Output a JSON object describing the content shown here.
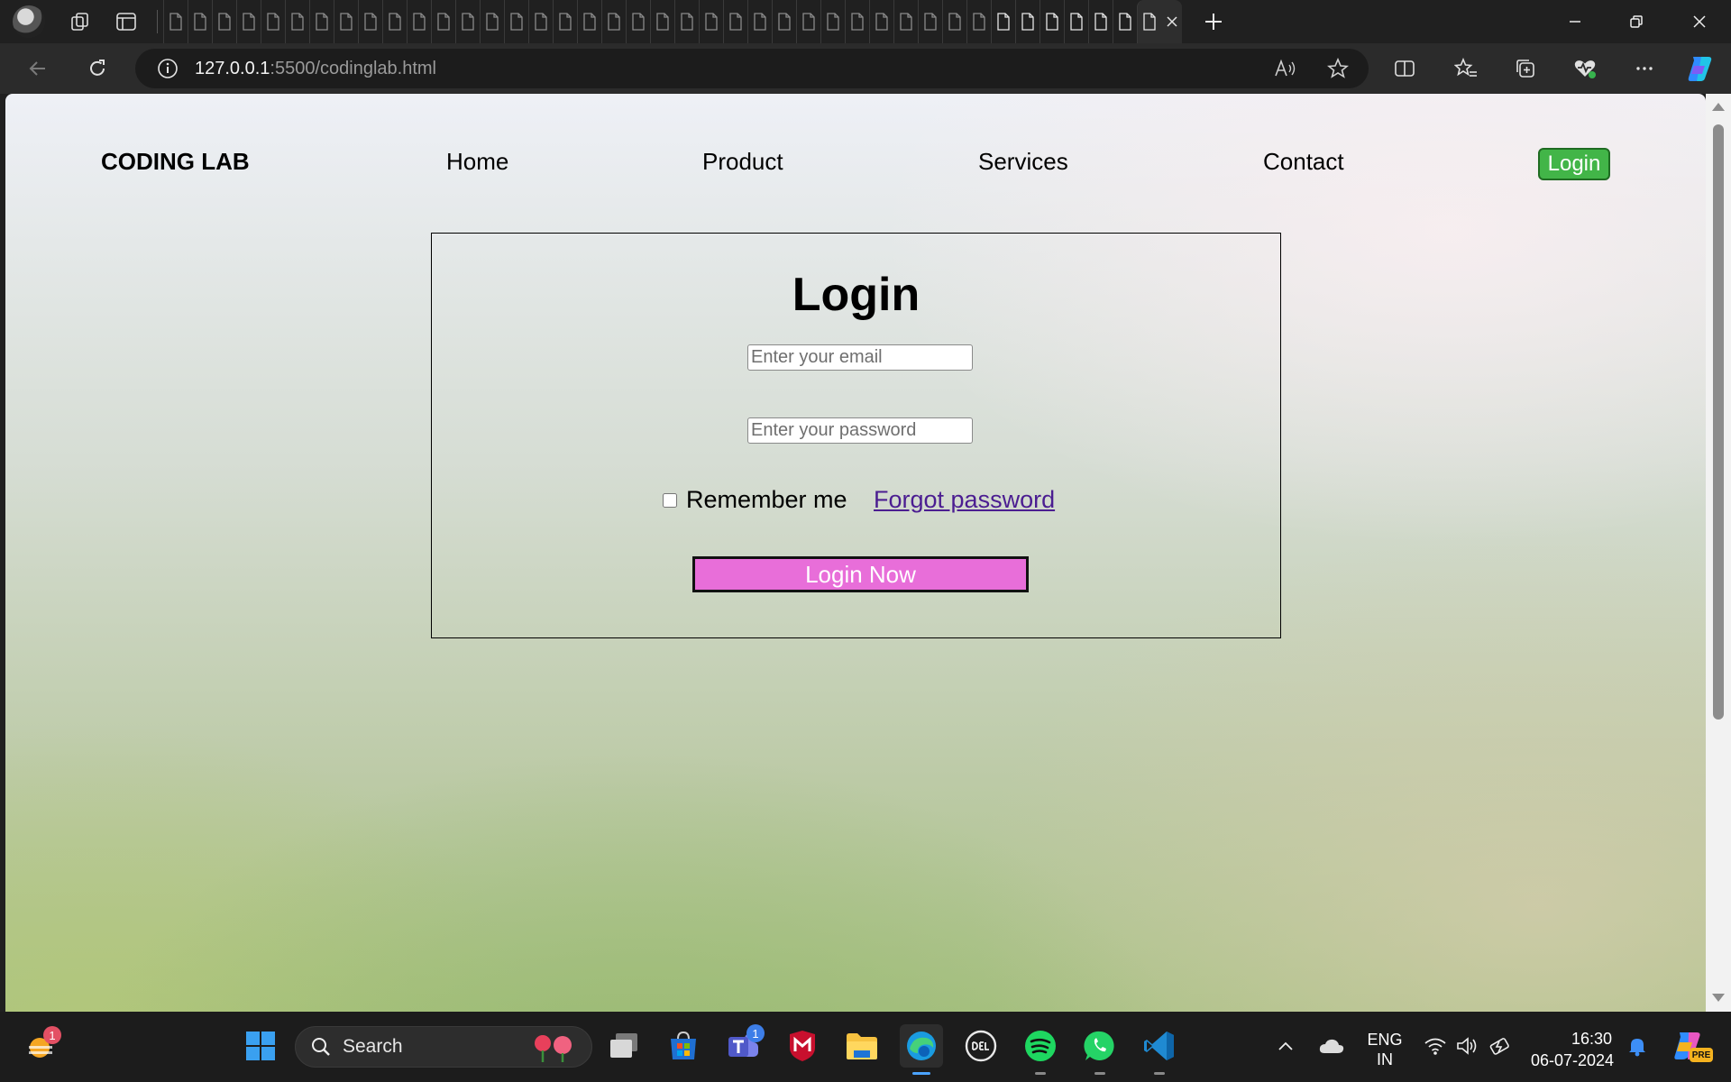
{
  "browser": {
    "address": {
      "host": "127.0.0.1",
      "path": ":5500/codinglab.html"
    }
  },
  "site": {
    "logo": "CODING LAB",
    "nav": [
      "Home",
      "Product",
      "Services",
      "Contact"
    ],
    "login_button": "Login"
  },
  "login_card": {
    "title": "Login",
    "email_placeholder": "Enter your email",
    "password_placeholder": "Enter your password",
    "remember_label": "Remember me",
    "forgot_link": "Forgot password",
    "submit_label": "Login Now"
  },
  "taskbar": {
    "weather_badge": "1",
    "search_label": "Search",
    "teams_badge": "1",
    "language_line1": "ENG",
    "language_line2": "IN",
    "time": "16:30",
    "date": "06-07-2024",
    "copilot_badge": "PRE"
  },
  "colors": {
    "login_button": "#42b548",
    "login_now_button": "#e86ed9",
    "forgot_link": "#4b1d91",
    "taskbar": "#1c1c1c"
  }
}
